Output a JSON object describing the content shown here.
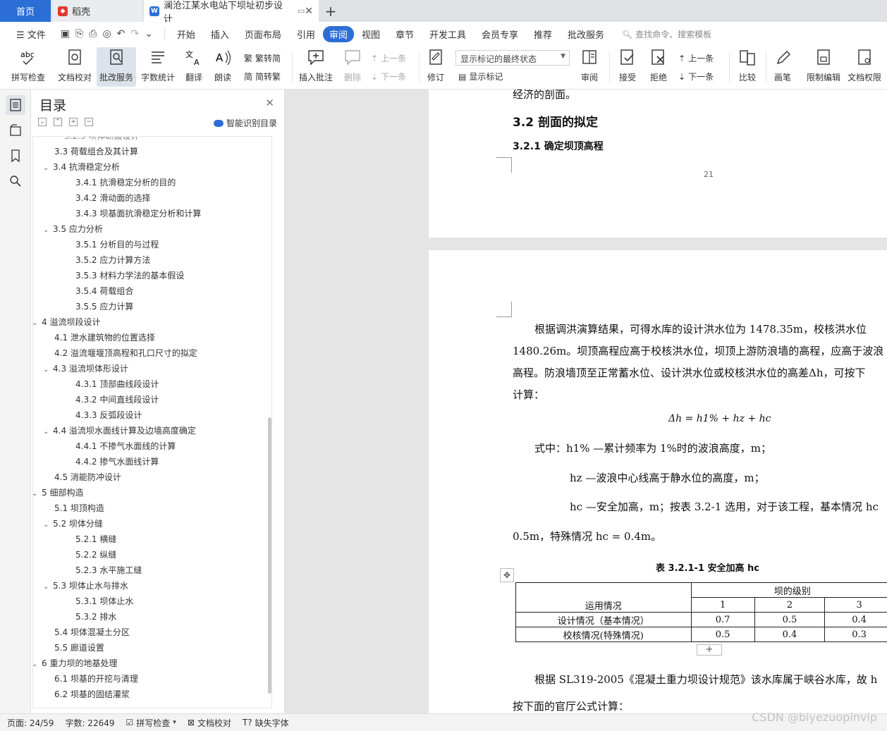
{
  "tabs": {
    "home": "首页",
    "daoke": "稻壳",
    "doc": "澜沧江某水电站下坝址初步设计",
    "plus": "+",
    "close": "✕"
  },
  "menu": {
    "file": "文件",
    "items": [
      "开始",
      "插入",
      "页面布局",
      "引用",
      "审阅",
      "视图",
      "章节",
      "开发工具",
      "会员专享",
      "推荐",
      "批改服务"
    ],
    "active": "审阅",
    "search": "查找命令、搜索模板"
  },
  "ribbon": {
    "spell": "拼写检查",
    "proof": "文档校对",
    "correct": "批改服务",
    "count": "字数统计",
    "translate": "翻译",
    "read": "朗读",
    "t2s": "繁转简",
    "s2t": "简转繁",
    "insert_comment": "插入批注",
    "delete": "删除",
    "prev": "上一条",
    "next": "下一条",
    "revise": "修订",
    "markup_state": "显示标记的最终状态",
    "show_markup": "显示标记",
    "review": "审阅",
    "accept": "接受",
    "reject": "拒绝",
    "prev2": "上一条",
    "next2": "下一条",
    "compare": "比较",
    "pen": "画笔",
    "restrict": "限制编辑",
    "rights": "文档权限"
  },
  "toc": {
    "title": "目录",
    "ai": "智能识别目录",
    "items": [
      {
        "text": "3.3 荷载组合及其计算",
        "level": 2,
        "chev": ""
      },
      {
        "text": "3.4 抗滑稳定分析",
        "level": 2,
        "chev": "v"
      },
      {
        "text": "3.4.1 抗滑稳定分析的目的",
        "level": 3,
        "chev": ""
      },
      {
        "text": "3.4.2 滑动面的选择",
        "level": 3,
        "chev": ""
      },
      {
        "text": "3.4.3 坝基面抗滑稳定分析和计算",
        "level": 3,
        "chev": ""
      },
      {
        "text": "3.5 应力分析",
        "level": 2,
        "chev": "v"
      },
      {
        "text": "3.5.1  分析目的与过程",
        "level": 3,
        "chev": ""
      },
      {
        "text": "3.5.2  应力计算方法",
        "level": 3,
        "chev": ""
      },
      {
        "text": "3.5.3  材料力学法的基本假设",
        "level": 3,
        "chev": ""
      },
      {
        "text": "3.5.4 荷载组合",
        "level": 3,
        "chev": ""
      },
      {
        "text": "3.5.5 应力计算",
        "level": 3,
        "chev": ""
      },
      {
        "text": "4  溢流坝段设计",
        "level": 1,
        "chev": "v"
      },
      {
        "text": "4.1 泄水建筑物的位置选择",
        "level": 2,
        "chev": ""
      },
      {
        "text": "4.2 溢流堰堰顶高程和孔口尺寸的拟定",
        "level": 2,
        "chev": ""
      },
      {
        "text": "4.3 溢流坝体形设计",
        "level": 2,
        "chev": "v"
      },
      {
        "text": "4.3.1 顶部曲线段设计",
        "level": 3,
        "chev": ""
      },
      {
        "text": "4.3.2 中间直线段设计",
        "level": 3,
        "chev": ""
      },
      {
        "text": "4.3.3 反弧段设计",
        "level": 3,
        "chev": ""
      },
      {
        "text": "4.4 溢流坝水面线计算及边墙高度确定",
        "level": 2,
        "chev": "v"
      },
      {
        "text": "4.4.1 不掺气水面线的计算",
        "level": 3,
        "chev": ""
      },
      {
        "text": "4.4.2 掺气水面线计算",
        "level": 3,
        "chev": ""
      },
      {
        "text": "4.5 消能防冲设计",
        "level": 2,
        "chev": ""
      },
      {
        "text": "5  细部构造",
        "level": 1,
        "chev": "v"
      },
      {
        "text": "5.1 坝顶构造",
        "level": 2,
        "chev": ""
      },
      {
        "text": "5.2 坝体分缝",
        "level": 2,
        "chev": "v"
      },
      {
        "text": "5.2.1 横缝",
        "level": 3,
        "chev": ""
      },
      {
        "text": "5.2.2 纵缝",
        "level": 3,
        "chev": ""
      },
      {
        "text": "5.2.3 水平施工缝",
        "level": 3,
        "chev": ""
      },
      {
        "text": "5.3 坝体止水与排水",
        "level": 2,
        "chev": "v"
      },
      {
        "text": "5.3.1 坝体止水",
        "level": 3,
        "chev": ""
      },
      {
        "text": "5.3.2 排水",
        "level": 3,
        "chev": ""
      },
      {
        "text": "5.4 坝体混凝土分区",
        "level": 2,
        "chev": ""
      },
      {
        "text": "5.5 廊道设置",
        "level": 2,
        "chev": ""
      },
      {
        "text": "6  重力坝的地基处理",
        "level": 1,
        "chev": "v"
      },
      {
        "text": "6.1 坝基的开挖与清理",
        "level": 2,
        "chev": ""
      },
      {
        "text": "6.2 坝基的固结灌浆",
        "level": 2,
        "chev": ""
      }
    ]
  },
  "doc": {
    "p1_line": "经济的剖面。",
    "h_3_2": "3.2 剖面的拟定",
    "h_3_2_1": "3.2.1 确定坝顶高程",
    "page_num": "21",
    "para1": [
      "根据调洪演算结果，可得水库的设计洪水位为 1478.35m，校核洪水位",
      "1480.26m。坝顶高程应高于校核洪水位，坝顶上游防浪墙的高程，应高于波浪",
      "高程。防浪墙顶至正常蓄水位、设计洪水位或校核洪水位的高差Δh，可按下",
      "计算："
    ],
    "formula": "Δh = h1% + hz + hc",
    "where1": "式中：h1% —累计频率为 1%时的波浪高度，m；",
    "where2": "hz —波浪中心线高于静水位的高度，m；",
    "where3": "hc —安全加高，m；按表 3.2-1 选用，对于该工程，基本情况  hc",
    "where4": "0.5m，特殊情况 hc = 0.4m。",
    "table_caption": "表 3.2.1-1 安全加高 hc",
    "table": {
      "col_head": "运用情况",
      "group_head": "坝的级别",
      "levels": [
        "1",
        "2",
        "3"
      ],
      "rows": [
        {
          "name": "设计情况（基本情况）",
          "vals": [
            "0.7",
            "0.5",
            "0.4"
          ]
        },
        {
          "name": "校核情况(特殊情况)",
          "vals": [
            "0.5",
            "0.4",
            "0.3"
          ]
        }
      ]
    },
    "para2": "根据 SL319-2005《混凝土重力坝设计规范》该水库属于峡谷水库，故 h",
    "para3": "按下面的官厅公式计算："
  },
  "status": {
    "page": "页面: 24/59",
    "words": "字数: 22649",
    "spell": "拼写检查",
    "proof": "文档校对",
    "font": "缺失字体"
  },
  "watermark": "CSDN @biyezuopinvip",
  "colors": {
    "accent": "#2b6fd6"
  }
}
